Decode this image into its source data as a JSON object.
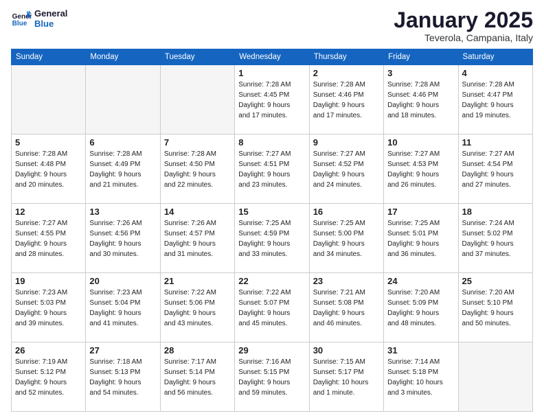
{
  "header": {
    "logo_line1": "General",
    "logo_line2": "Blue",
    "month": "January 2025",
    "location": "Teverola, Campania, Italy"
  },
  "weekdays": [
    "Sunday",
    "Monday",
    "Tuesday",
    "Wednesday",
    "Thursday",
    "Friday",
    "Saturday"
  ],
  "weeks": [
    [
      {
        "day": "",
        "info": ""
      },
      {
        "day": "",
        "info": ""
      },
      {
        "day": "",
        "info": ""
      },
      {
        "day": "1",
        "info": "Sunrise: 7:28 AM\nSunset: 4:45 PM\nDaylight: 9 hours\nand 17 minutes."
      },
      {
        "day": "2",
        "info": "Sunrise: 7:28 AM\nSunset: 4:46 PM\nDaylight: 9 hours\nand 17 minutes."
      },
      {
        "day": "3",
        "info": "Sunrise: 7:28 AM\nSunset: 4:46 PM\nDaylight: 9 hours\nand 18 minutes."
      },
      {
        "day": "4",
        "info": "Sunrise: 7:28 AM\nSunset: 4:47 PM\nDaylight: 9 hours\nand 19 minutes."
      }
    ],
    [
      {
        "day": "5",
        "info": "Sunrise: 7:28 AM\nSunset: 4:48 PM\nDaylight: 9 hours\nand 20 minutes."
      },
      {
        "day": "6",
        "info": "Sunrise: 7:28 AM\nSunset: 4:49 PM\nDaylight: 9 hours\nand 21 minutes."
      },
      {
        "day": "7",
        "info": "Sunrise: 7:28 AM\nSunset: 4:50 PM\nDaylight: 9 hours\nand 22 minutes."
      },
      {
        "day": "8",
        "info": "Sunrise: 7:27 AM\nSunset: 4:51 PM\nDaylight: 9 hours\nand 23 minutes."
      },
      {
        "day": "9",
        "info": "Sunrise: 7:27 AM\nSunset: 4:52 PM\nDaylight: 9 hours\nand 24 minutes."
      },
      {
        "day": "10",
        "info": "Sunrise: 7:27 AM\nSunset: 4:53 PM\nDaylight: 9 hours\nand 26 minutes."
      },
      {
        "day": "11",
        "info": "Sunrise: 7:27 AM\nSunset: 4:54 PM\nDaylight: 9 hours\nand 27 minutes."
      }
    ],
    [
      {
        "day": "12",
        "info": "Sunrise: 7:27 AM\nSunset: 4:55 PM\nDaylight: 9 hours\nand 28 minutes."
      },
      {
        "day": "13",
        "info": "Sunrise: 7:26 AM\nSunset: 4:56 PM\nDaylight: 9 hours\nand 30 minutes."
      },
      {
        "day": "14",
        "info": "Sunrise: 7:26 AM\nSunset: 4:57 PM\nDaylight: 9 hours\nand 31 minutes."
      },
      {
        "day": "15",
        "info": "Sunrise: 7:25 AM\nSunset: 4:59 PM\nDaylight: 9 hours\nand 33 minutes."
      },
      {
        "day": "16",
        "info": "Sunrise: 7:25 AM\nSunset: 5:00 PM\nDaylight: 9 hours\nand 34 minutes."
      },
      {
        "day": "17",
        "info": "Sunrise: 7:25 AM\nSunset: 5:01 PM\nDaylight: 9 hours\nand 36 minutes."
      },
      {
        "day": "18",
        "info": "Sunrise: 7:24 AM\nSunset: 5:02 PM\nDaylight: 9 hours\nand 37 minutes."
      }
    ],
    [
      {
        "day": "19",
        "info": "Sunrise: 7:23 AM\nSunset: 5:03 PM\nDaylight: 9 hours\nand 39 minutes."
      },
      {
        "day": "20",
        "info": "Sunrise: 7:23 AM\nSunset: 5:04 PM\nDaylight: 9 hours\nand 41 minutes."
      },
      {
        "day": "21",
        "info": "Sunrise: 7:22 AM\nSunset: 5:06 PM\nDaylight: 9 hours\nand 43 minutes."
      },
      {
        "day": "22",
        "info": "Sunrise: 7:22 AM\nSunset: 5:07 PM\nDaylight: 9 hours\nand 45 minutes."
      },
      {
        "day": "23",
        "info": "Sunrise: 7:21 AM\nSunset: 5:08 PM\nDaylight: 9 hours\nand 46 minutes."
      },
      {
        "day": "24",
        "info": "Sunrise: 7:20 AM\nSunset: 5:09 PM\nDaylight: 9 hours\nand 48 minutes."
      },
      {
        "day": "25",
        "info": "Sunrise: 7:20 AM\nSunset: 5:10 PM\nDaylight: 9 hours\nand 50 minutes."
      }
    ],
    [
      {
        "day": "26",
        "info": "Sunrise: 7:19 AM\nSunset: 5:12 PM\nDaylight: 9 hours\nand 52 minutes."
      },
      {
        "day": "27",
        "info": "Sunrise: 7:18 AM\nSunset: 5:13 PM\nDaylight: 9 hours\nand 54 minutes."
      },
      {
        "day": "28",
        "info": "Sunrise: 7:17 AM\nSunset: 5:14 PM\nDaylight: 9 hours\nand 56 minutes."
      },
      {
        "day": "29",
        "info": "Sunrise: 7:16 AM\nSunset: 5:15 PM\nDaylight: 9 hours\nand 59 minutes."
      },
      {
        "day": "30",
        "info": "Sunrise: 7:15 AM\nSunset: 5:17 PM\nDaylight: 10 hours\nand 1 minute."
      },
      {
        "day": "31",
        "info": "Sunrise: 7:14 AM\nSunset: 5:18 PM\nDaylight: 10 hours\nand 3 minutes."
      },
      {
        "day": "",
        "info": ""
      }
    ]
  ]
}
